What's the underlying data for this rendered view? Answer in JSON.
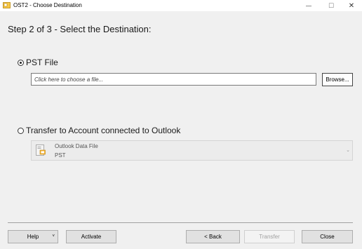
{
  "window": {
    "title": "OST2 - Choose Destination",
    "minimize_glyph": "—",
    "maximize_glyph": "☐",
    "close_glyph": "✕"
  },
  "step_title": "Step 2 of 3 - Select the Destination:",
  "options": {
    "pst": {
      "label": "PST File",
      "selected": true,
      "file_placeholder": "Click here to choose a file...",
      "file_value": "",
      "browse_label": "Browse..."
    },
    "account": {
      "label": "Transfer to Account connected to Outlook",
      "selected": false,
      "dropdown": {
        "line1": "Outlook Data File",
        "line2": "PST",
        "icon": "outlook-data-file-icon",
        "chevron": "⌄"
      }
    }
  },
  "footer": {
    "help_label": "Help",
    "help_arrow": "˅",
    "activate_label": "Activate",
    "back_label": "< Back",
    "transfer_label": "Transfer",
    "close_label": "Close"
  }
}
